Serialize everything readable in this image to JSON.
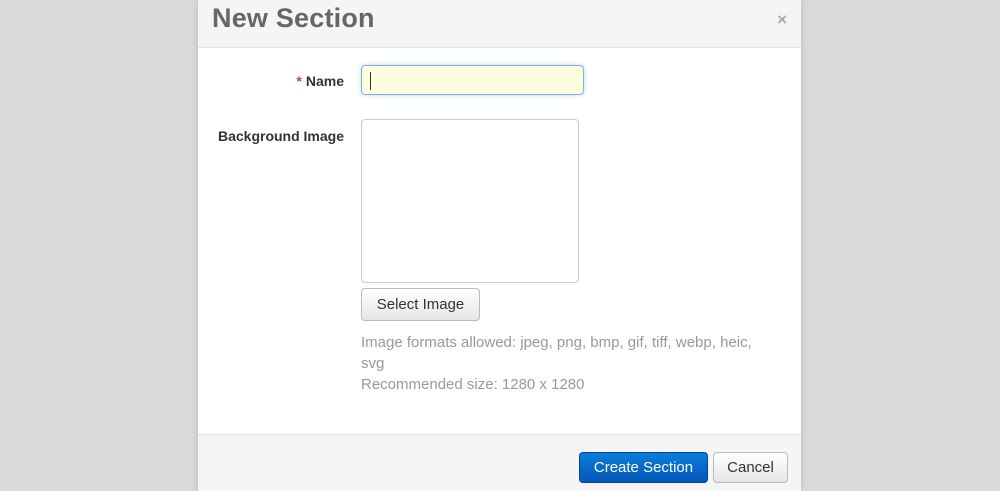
{
  "dialog": {
    "title": "New Section",
    "close_glyph": "×"
  },
  "form": {
    "name_required_mark": "*",
    "name_label": "Name",
    "name_value": "",
    "background_label": "Background Image",
    "select_image_label": "Select Image",
    "help_formats_line1": "Image formats allowed: jpeg, png, bmp, gif, tiff, webp, heic,",
    "help_formats_line2": "svg",
    "help_size": "Recommended size: 1280 x 1280"
  },
  "footer": {
    "create_label": "Create Section",
    "cancel_label": "Cancel"
  },
  "colors": {
    "primary_button": "#0a6fd0",
    "input_focus_bg": "#ffffe0",
    "required_mark": "#b94a48"
  }
}
